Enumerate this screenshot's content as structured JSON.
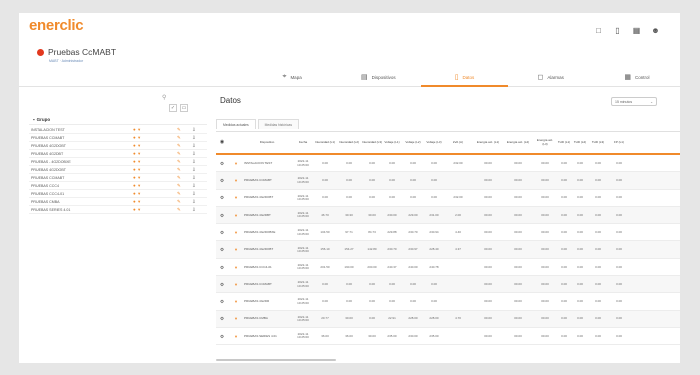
{
  "brand": {
    "logo": "enerclic",
    "accent": "#f08a2b",
    "status_color": "#e2381e"
  },
  "topbar": {
    "icons": [
      "window-icon",
      "document-icon",
      "grid-icon",
      "users-icon"
    ]
  },
  "site": {
    "name": "Pruebas CcMABT",
    "subtitle": "MABT · Administrador"
  },
  "nav": {
    "tabs": [
      {
        "label": "Mapa",
        "icon": "map-pin-icon",
        "glyph": "⌖",
        "active": false
      },
      {
        "label": "Dispositivos",
        "icon": "device-icon",
        "glyph": "▤",
        "active": false
      },
      {
        "label": "Datos",
        "icon": "data-icon",
        "glyph": "▯",
        "active": true
      },
      {
        "label": "Alarmas",
        "icon": "alarm-icon",
        "glyph": "◻",
        "active": false
      },
      {
        "label": "Control",
        "icon": "control-icon",
        "glyph": "▦",
        "active": false
      }
    ]
  },
  "left": {
    "group_label": "Grupo",
    "devices": [
      "INSTALACION TEST",
      "PRUEBAS CCMABT",
      "PRUEBAS 4G2DOBT",
      "PRUEBAS 4G2DBT",
      "PRUEBAS - 4G2DOBXE",
      "PRUEBAS 4G2DOBT",
      "PRUEBAS CCMABT",
      "PRUEBAS CCC4",
      "PRUEBAS CCC4-01",
      "PRUEBAS CMBA",
      "PRUEBAS SERIES 4.01"
    ]
  },
  "datos": {
    "title": "Datos",
    "select_value": "15 minutos",
    "tabs": [
      "Medidas actuales",
      "Medidas históricas"
    ],
    "columns": [
      "Dispositivo",
      "Fecha",
      "Intensidad (L1)",
      "Intensidad (L2)",
      "Intensidad (L3)",
      "Voltaje (L1)",
      "Voltaje (L2)",
      "Voltaje (L3)",
      "kVA (A)",
      "Energía act. (L1)",
      "Energía act. (L2)",
      "Energía act. (L3)",
      "THD (L1)",
      "THD (L2)",
      "THD (L3)",
      "FP (L1)"
    ],
    "rows": [
      {
        "device": "INSTALACION TEST",
        "date": "2022-11 10:25:00",
        "values": [
          "0.00",
          "0.00",
          "0.00",
          "0.00",
          "0.00",
          "0.00",
          "232.00",
          "00.00",
          "00.00",
          "00.00",
          "0.00",
          "0.00",
          "0.00",
          "0.00"
        ]
      },
      {
        "device": "PRUEBAS CCMABT",
        "date": "2022-11 10:25:00",
        "values": [
          "0.00",
          "0.00",
          "0.00",
          "0.00",
          "0.00",
          "0.00",
          "",
          "00.00",
          "00.00",
          "00.00",
          "0.00",
          "0.00",
          "0.00",
          "0.00"
        ]
      },
      {
        "device": "PRUEBAS 4G2DOBT",
        "date": "2022-11 10:25:00",
        "values": [
          "0.00",
          "0.00",
          "0.00",
          "0.00",
          "0.00",
          "0.00",
          "232.00",
          "00.00",
          "00.00",
          "00.00",
          "0.00",
          "0.00",
          "0.00",
          "0.00"
        ]
      },
      {
        "device": "PRUEBAS 4G2DBT",
        "date": "2022-11 10:25:00",
        "values": [
          "46.70",
          "30.30",
          "30.00",
          "230.00",
          "229.00",
          "231.00",
          "2.00",
          "00.00",
          "00.00",
          "00.00",
          "0.00",
          "0.00",
          "0.00",
          "0.00"
        ]
      },
      {
        "device": "PRUEBAS 4G2DOBXE",
        "date": "2022-11 10:25:00",
        "values": [
          "104.50",
          "97.71",
          "84.73",
          "229.88",
          "230.70",
          "230.94",
          "4.40",
          "00.00",
          "00.00",
          "00.00",
          "0.00",
          "0.00",
          "0.00",
          "0.00"
        ]
      },
      {
        "device": "PRUEBAS 4G2DOBT",
        "date": "2022-11 10:25:00",
        "values": [
          "156.10",
          "154.27",
          "142.80",
          "230.70",
          "230.97",
          "228.40",
          "4.37",
          "00.00",
          "00.00",
          "00.00",
          "0.00",
          "0.00",
          "0.00",
          "0.00"
        ]
      },
      {
        "device": "PRUEBAS CCC4-01",
        "date": "2022-11 10:25:00",
        "values": [
          "201.50",
          "190.00",
          "200.00",
          "240.37",
          "240.00",
          "240.78",
          "",
          "00.00",
          "00.00",
          "00.00",
          "0.00",
          "0.00",
          "0.00",
          "0.00"
        ]
      },
      {
        "device": "PRUEBAS CCMABT",
        "date": "2022-11 10:25:00",
        "values": [
          "0.00",
          "0.00",
          "0.00",
          "0.00",
          "0.00",
          "0.00",
          "",
          "00.00",
          "00.00",
          "00.00",
          "0.00",
          "0.00",
          "0.00",
          "0.00"
        ]
      },
      {
        "device": "PRUEBAS 4G2DR",
        "date": "2022-11 10:25:00",
        "values": [
          "0.00",
          "0.00",
          "0.00",
          "0.00",
          "0.00",
          "0.00",
          "",
          "00.00",
          "00.00",
          "00.00",
          "0.00",
          "0.00",
          "0.00",
          "0.00"
        ]
      },
      {
        "device": "PRUEBAS CMBA",
        "date": "2022-11 10:25:00",
        "values": [
          "20.77",
          "30.00",
          "0.00",
          "22.91",
          "228.00",
          "228.00",
          "4.70",
          "00.00",
          "00.00",
          "00.00",
          "0.00",
          "0.00",
          "0.00",
          "0.00"
        ]
      },
      {
        "device": "PRUEBAS SERIES 4.01",
        "date": "2022-11 10:25:00",
        "values": [
          "36.00",
          "36.00",
          "30.00",
          "235.00",
          "230.00",
          "235.00",
          "",
          "00.00",
          "00.00",
          "00.00",
          "0.00",
          "0.00",
          "0.00",
          "0.00"
        ]
      }
    ]
  }
}
